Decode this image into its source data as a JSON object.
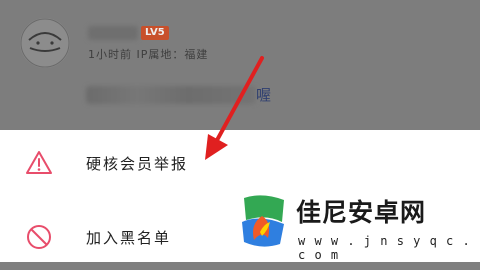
{
  "post": {
    "level_badge": "LV5",
    "meta": "1小时前 IP属地：福建",
    "content_tail": "喔"
  },
  "menu": {
    "report_label": "硬核会员举报",
    "blacklist_label": "加入黑名单"
  },
  "icons": {
    "report": "warning-triangle-icon",
    "blacklist": "block-circle-icon"
  },
  "colors": {
    "annotation_arrow": "#e02020",
    "warning_icon": "#e84d6b",
    "level_badge": "#c8502b"
  },
  "watermark": {
    "title": "佳尼安卓网",
    "url": "w w w . j n s y q c . c o m"
  }
}
